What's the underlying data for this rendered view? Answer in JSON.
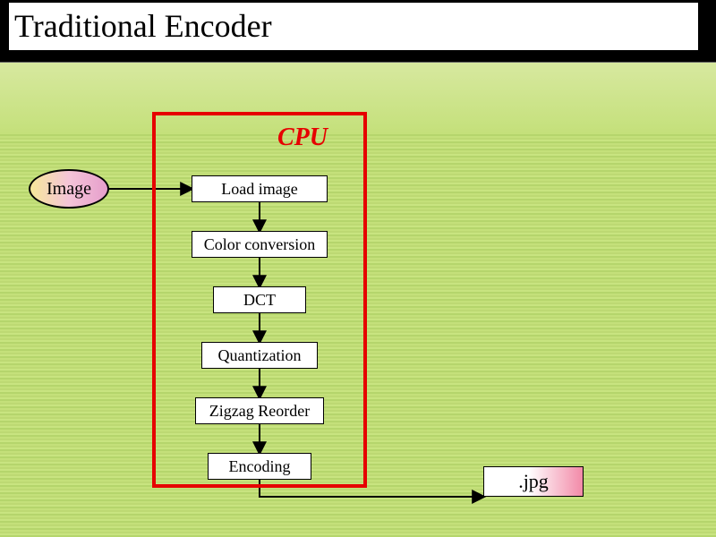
{
  "title": "Traditional Encoder",
  "diagram": {
    "input_label": "Image",
    "container_label": "CPU",
    "steps": [
      "Load image",
      "Color conversion",
      "DCT",
      "Quantization",
      "Zigzag Reorder",
      "Encoding"
    ],
    "output_label": ".jpg"
  }
}
